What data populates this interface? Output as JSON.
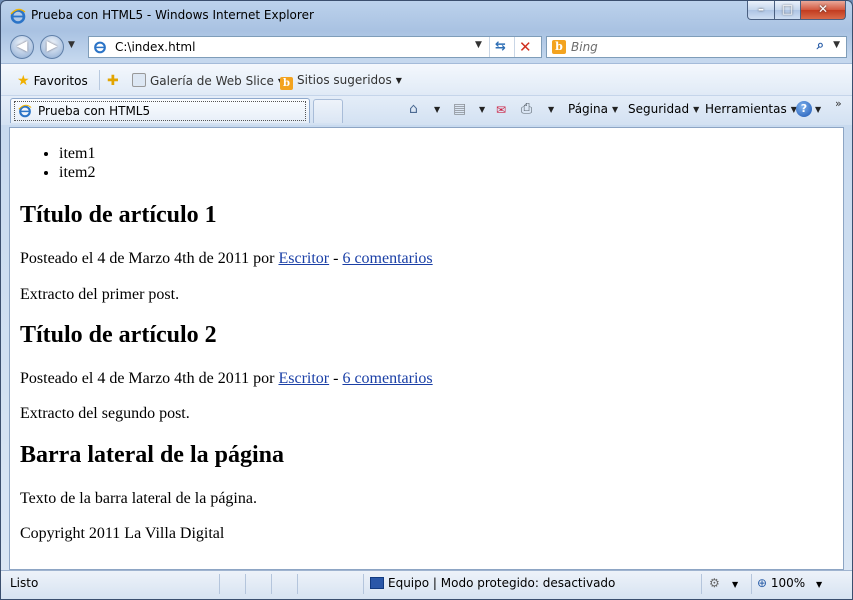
{
  "window": {
    "title": "Prueba con HTML5 - Windows Internet Explorer",
    "minimize": "–",
    "maximize": "□",
    "close": "✕"
  },
  "nav": {
    "back_icon": "back-arrow-icon",
    "forward_icon": "forward-arrow-icon",
    "back_glyph": "◀",
    "forward_glyph": "▶",
    "address": "C:\\index.html",
    "search_placeholder": "Bing",
    "search_glyph": "⌕",
    "stop_glyph": "✕",
    "refresh_glyph": "⇆"
  },
  "favorites_bar": {
    "favorites": "Favoritos",
    "gallery": "Galería de Web Slice",
    "suggested": "Sitios sugeridos"
  },
  "tabs": [
    {
      "label": "Prueba con HTML5",
      "active": true
    }
  ],
  "commands": {
    "page": "Página",
    "security": "Seguridad",
    "tools": "Herramientas",
    "help": "?",
    "more": "»"
  },
  "content": {
    "list": [
      "item1",
      "item2"
    ],
    "articles": [
      {
        "title": "Título de artículo 1",
        "meta_prefix": "Posteado el 4 de Marzo 4th de 2011 por ",
        "author": "Escritor",
        "sep": " - ",
        "comments": "6 comentarios",
        "excerpt": "Extracto del primer post."
      },
      {
        "title": "Título de artículo 2",
        "meta_prefix": "Posteado el 4 de Marzo 4th de 2011 por ",
        "author": "Escritor",
        "sep": " - ",
        "comments": "6 comentarios",
        "excerpt": "Extracto del segundo post."
      }
    ],
    "sidebar_title": "Barra lateral de la página",
    "sidebar_text": "Texto de la barra lateral de la página.",
    "footer": "Copyright 2011 La Villa Digital"
  },
  "status": {
    "state": "Listo",
    "zone": "Equipo | Modo protegido: desactivado",
    "zoom": "100%"
  },
  "colors": {
    "link": "#1a3fa6",
    "frame": "#a9c2e2"
  }
}
